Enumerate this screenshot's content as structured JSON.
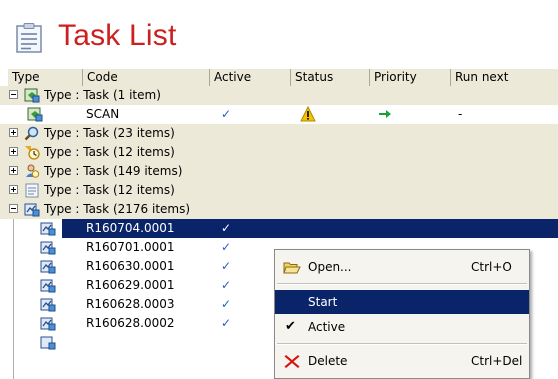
{
  "app": {
    "title": "Task List"
  },
  "columns": [
    "Type",
    "Code",
    "Active",
    "Status",
    "Priority",
    "Run next"
  ],
  "groups": [
    {
      "label": "Type : Task (1 item)",
      "expanded": true
    },
    {
      "label": "Type : Task (23 items)",
      "expanded": false
    },
    {
      "label": "Type : Task (12 items)",
      "expanded": false
    },
    {
      "label": "Type : Task (149 items)",
      "expanded": false
    },
    {
      "label": "Type : Task (12 items)",
      "expanded": false
    },
    {
      "label": "Type : Task (2176 items)",
      "expanded": true
    }
  ],
  "scan_row": {
    "code": "SCAN",
    "active": "✓",
    "status_icon": "warning-icon",
    "priority_icon": "green-arrow-icon",
    "run_next": "-"
  },
  "task_rows": [
    {
      "code": "R160704.0001",
      "active": "✓",
      "selected": true
    },
    {
      "code": "R160701.0001",
      "active": "✓"
    },
    {
      "code": "R160630.0001",
      "active": "✓"
    },
    {
      "code": "R160629.0001",
      "active": "✓"
    },
    {
      "code": "R160628.0003",
      "active": "✓"
    },
    {
      "code": "R160628.0002",
      "active": "✓"
    }
  ],
  "context_menu": {
    "open": {
      "label": "Open...",
      "shortcut": "Ctrl+O"
    },
    "start": {
      "label": "Start"
    },
    "active": {
      "label": "Active",
      "checked": "✔"
    },
    "delete": {
      "label": "Delete",
      "shortcut": "Ctrl+Del"
    }
  },
  "colors": {
    "title": "#cc1f1f",
    "selection": "#0a246a",
    "check": "#1f5fc8",
    "warning": "#f5c400",
    "arrow": "#1e9e3a",
    "delete": "#d81414"
  }
}
